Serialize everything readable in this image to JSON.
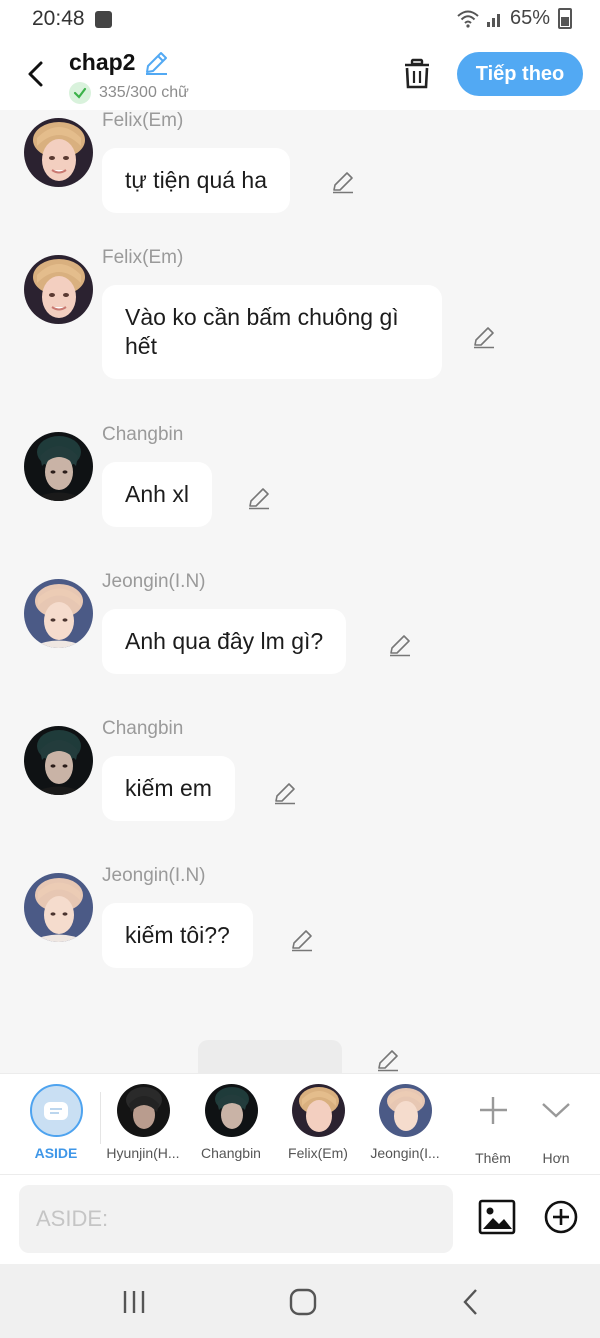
{
  "status": {
    "time": "20:48",
    "battery": "65%"
  },
  "header": {
    "title": "chap2",
    "word_count": "335/300 chữ",
    "next_label": "Tiếp theo"
  },
  "messages": [
    {
      "sender": "Felix(Em)",
      "text": "tự tiện quá ha",
      "avatar": "felix"
    },
    {
      "sender": "Felix(Em)",
      "text": "Vào ko cần bấm chuông gì hết",
      "avatar": "felix"
    },
    {
      "sender": "Changbin",
      "text": "Anh xl",
      "avatar": "changbin"
    },
    {
      "sender": "Jeongin(I.N)",
      "text": "Anh qua đây lm gì?",
      "avatar": "jeongin"
    },
    {
      "sender": "Changbin",
      "text": "kiếm em",
      "avatar": "changbin"
    },
    {
      "sender": "Jeongin(I.N)",
      "text": "kiếm tôi??",
      "avatar": "jeongin"
    }
  ],
  "characters": [
    {
      "label": "ASIDE",
      "selected": true
    },
    {
      "label": "Hyunjin(H...",
      "avatar": "hyunjin"
    },
    {
      "label": "Changbin",
      "avatar": "changbin"
    },
    {
      "label": "Felix(Em)",
      "avatar": "felix"
    },
    {
      "label": "Jeongin(I...",
      "avatar": "jeongin"
    }
  ],
  "actions": {
    "add_label": "Thêm",
    "more_label": "Hơn"
  },
  "input": {
    "placeholder": "ASIDE:"
  },
  "colors": {
    "accent": "#52a9f3",
    "aside_selected": "#4ea3ef",
    "check_green": "#3cb24a"
  }
}
